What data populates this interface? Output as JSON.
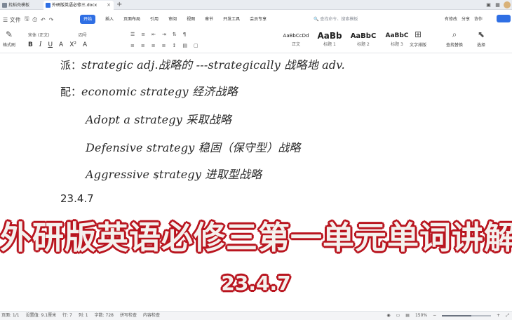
{
  "tabs": [
    {
      "label": "找稻壳模板"
    },
    {
      "label": "外研版英语必修三.docx",
      "close": "×"
    }
  ],
  "tab_add": "+",
  "menu": {
    "file": "☰ 文件",
    "tabs": [
      "开始",
      "插入",
      "页面布局",
      "引用",
      "审阅",
      "视图",
      "章节",
      "开发工具",
      "会员专享"
    ],
    "search": "🔍 查找命令、搜索模板",
    "right": [
      "有修改",
      "分享",
      "协作"
    ]
  },
  "ribbon": {
    "format_painter": "格式刷",
    "font_name": "宋体 (正文)",
    "font_size": "四号",
    "bold": "B",
    "italic": "I",
    "underline": "U",
    "styles": [
      {
        "sample": "AaBbCcDd",
        "name": "正文"
      },
      {
        "sample": "AaBb",
        "name": "标题 1"
      },
      {
        "sample": "AaBbC",
        "name": "标题 2"
      },
      {
        "sample": "AaBbC",
        "name": "标题 3"
      }
    ],
    "text_tools": "文字排版",
    "find_replace": "查找替换",
    "select": "选择"
  },
  "document": {
    "lines": [
      {
        "marker": "派：",
        "text": "strategic adj.战略的  ---strategically 战略地  adv."
      },
      {
        "marker": "配：",
        "text": "economic strategy 经济战略"
      },
      {
        "marker": "",
        "text": "Adopt a strategy 采取战略"
      },
      {
        "marker": "",
        "text": "Defensive strategy 稳固（保守型）战略"
      },
      {
        "marker": "",
        "text": "Aggressive strategy 进取型战略"
      }
    ],
    "date": "23.4.7"
  },
  "overlay": {
    "title": "外研版英语必修三第一单元单词讲解",
    "date": "23.4.7"
  },
  "status": {
    "left": [
      "页面: 1/1",
      "设置值: 9.1厘米",
      "行: 7",
      "列: 1",
      "字数: 728",
      "拼写检查",
      "内容检查"
    ],
    "zoom": "150%",
    "zoom_level": 0.6
  }
}
